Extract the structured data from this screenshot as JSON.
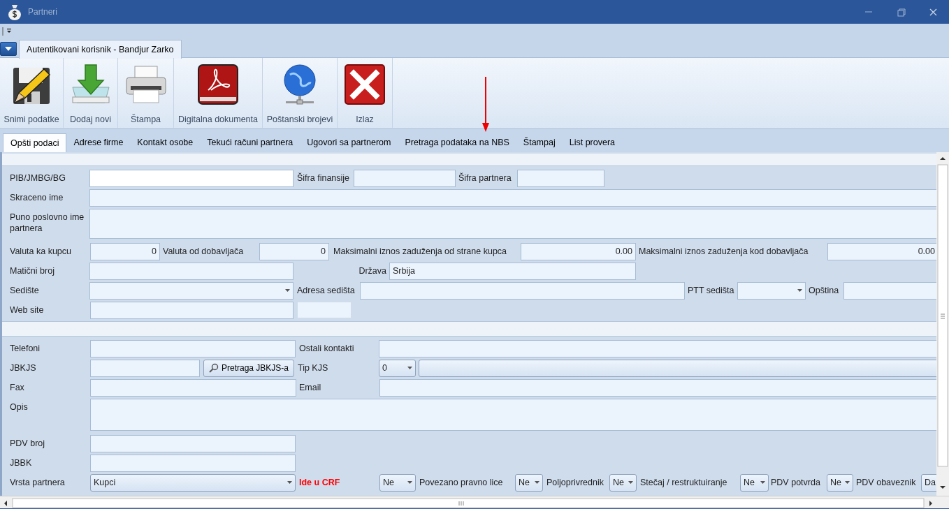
{
  "window": {
    "title": "Partneri"
  },
  "ribbon": {
    "tabs": [
      {
        "label": "Autentikovani korisnik - Bandjur Zarko",
        "selected": true
      }
    ],
    "buttons": [
      {
        "kind": "save",
        "label": "Snimi podatke"
      },
      {
        "kind": "add",
        "label": "Dodaj novi"
      },
      {
        "kind": "print",
        "label": "Štampa"
      },
      {
        "kind": "documents",
        "label": "Digitalna dokumenta"
      },
      {
        "kind": "postal",
        "label": "Poštanski brojevi"
      },
      {
        "kind": "exit",
        "label": "Izlaz"
      }
    ]
  },
  "tabs": [
    {
      "label": "Opšti podaci",
      "selected": true
    },
    {
      "label": "Adrese firme",
      "selected": false
    },
    {
      "label": "Kontakt osobe",
      "selected": false
    },
    {
      "label": "Tekući računi partnera",
      "selected": false
    },
    {
      "label": "Ugovori sa partnerom",
      "selected": false
    },
    {
      "label": "Pretraga podataka na NBS",
      "selected": false
    },
    {
      "label": "Štampaj",
      "selected": false
    },
    {
      "label": "List provera",
      "selected": false
    }
  ],
  "sections": [
    {
      "rows": [
        {
          "fields": [
            {
              "label": "PIB/JMBG/BG",
              "kind": "input",
              "focused": true
            },
            {
              "label": "Šifra finansije",
              "kind": "input",
              "focused": false
            },
            {
              "label": "Šifra partnera",
              "kind": "input",
              "focused": false
            }
          ]
        },
        {
          "fields": [
            {
              "label": "Skraceno ime",
              "kind": "input",
              "focused": false
            }
          ]
        },
        {
          "fields": [
            {
              "label": "Puno poslovno ime partnera",
              "kind": "textarea"
            }
          ]
        },
        {
          "fields": [
            {
              "label": "Valuta ka kupcu",
              "kind": "number",
              "value": "0"
            },
            {
              "label": "Valuta od dobavljača",
              "kind": "number",
              "value": "0"
            },
            {
              "label": "Maksimalni iznos zaduženja od strane kupca",
              "kind": "number",
              "value": "0.00"
            },
            {
              "label": "Maksimalni iznos zaduženja kod dobavljača",
              "kind": "number",
              "value": "0.00"
            }
          ]
        },
        {
          "fields": [
            {
              "label": "Matični broj",
              "kind": "input",
              "focused": false
            },
            {
              "label": "Država",
              "kind": "input",
              "value": "Srbija",
              "focused": false
            }
          ]
        },
        {
          "fields": [
            {
              "label": "Sedište",
              "kind": "combo"
            },
            {
              "label": "Adresa sedišta",
              "kind": "input",
              "focused": false
            },
            {
              "label": "PTT sedišta",
              "kind": "combo"
            },
            {
              "label": "Opština",
              "kind": "input",
              "focused": false
            }
          ]
        },
        {
          "fields": [
            {
              "label": "Web site",
              "kind": "input",
              "focused": false
            },
            {
              "kind": "blank"
            }
          ]
        }
      ]
    },
    {
      "rows": [
        {
          "fields": [
            {
              "label": "Telefoni",
              "kind": "input",
              "focused": false
            },
            {
              "label": "Ostali kontakti",
              "kind": "input",
              "focused": false
            }
          ]
        },
        {
          "fields": [
            {
              "label": "JBKJS",
              "kind": "input",
              "focused": false
            },
            {
              "kind": "button",
              "text": "Pretraga JBKJS-a"
            },
            {
              "label": "Tip KJS",
              "kind": "dropdown",
              "value": "0"
            },
            {
              "kind": "bar"
            }
          ]
        },
        {
          "fields": [
            {
              "label": "Fax",
              "kind": "input",
              "focused": false
            },
            {
              "label": "Email",
              "kind": "input",
              "focused": false
            }
          ]
        },
        {
          "fields": [
            {
              "label": "Opis",
              "kind": "textarea"
            }
          ]
        },
        {
          "fields": [
            {
              "label": "PDV broj",
              "kind": "input",
              "focused": false
            }
          ]
        },
        {
          "fields": [
            {
              "label": "JBBK",
              "kind": "input",
              "focused": false
            }
          ]
        },
        {
          "fields": [
            {
              "label": "Vrsta partnera",
              "kind": "dropdown",
              "value": "Kupci"
            },
            {
              "label": "Ide u CRF",
              "warning": true,
              "kind": "dropdown",
              "value": "Ne"
            },
            {
              "label": "Povezano pravno lice",
              "kind": "dropdown",
              "value": "Ne"
            },
            {
              "label": "Poljoprivrednik",
              "kind": "dropdown",
              "value": "Ne"
            },
            {
              "label": "Stečaj / restruktuiranje",
              "kind": "dropdown",
              "value": "Ne"
            },
            {
              "label": "PDV potvrda",
              "kind": "dropdown",
              "value": "Ne"
            },
            {
              "label": "PDV obaveznik",
              "kind": "dropdown",
              "value": "Da"
            }
          ]
        }
      ]
    }
  ],
  "annotations": [
    {
      "kind": "arrow"
    }
  ]
}
